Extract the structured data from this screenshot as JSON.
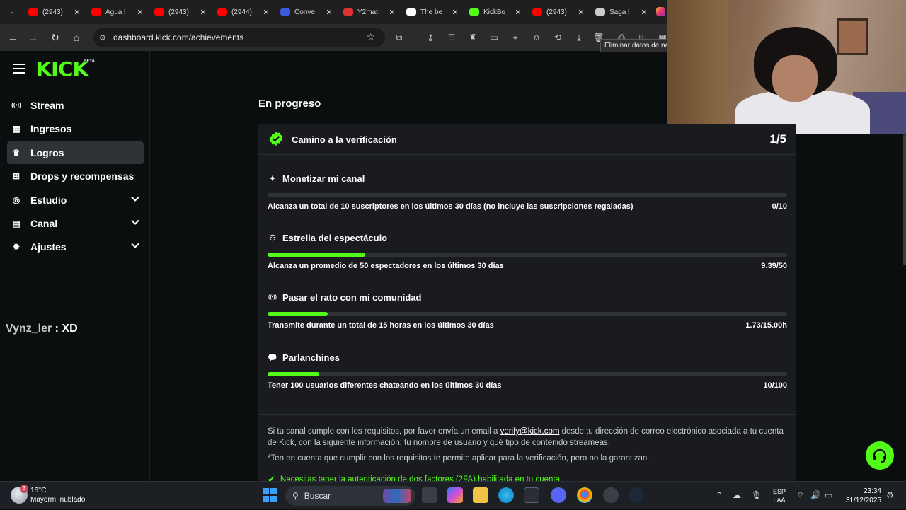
{
  "browser": {
    "tabs": [
      {
        "title": "(2943)",
        "color": "#ff0000"
      },
      {
        "title": "Agua l",
        "color": "#ff0000"
      },
      {
        "title": "(2943)",
        "color": "#ff0000"
      },
      {
        "title": "(2944)",
        "color": "#ff0000"
      },
      {
        "title": "Conve",
        "color": "#3b5bdb"
      },
      {
        "title": "Y2mat",
        "color": "#e03131"
      },
      {
        "title": "The be",
        "color": "#ffffff"
      },
      {
        "title": "KickBo",
        "color": "#53fc18"
      },
      {
        "title": "(2943)",
        "color": "#ff0000"
      },
      {
        "title": "Saga l",
        "color": "#cccccc"
      }
    ],
    "url": "dashboard.kick.com/achievements",
    "tooltip": "Eliminar datos de na"
  },
  "sidebar": {
    "logo": "KICK",
    "logo_badge": "BETA",
    "items": [
      {
        "label": "Stream",
        "icon": "stream-icon",
        "active": false,
        "expandable": false
      },
      {
        "label": "Ingresos",
        "icon": "revenue-icon",
        "active": false,
        "expandable": false
      },
      {
        "label": "Logros",
        "icon": "trophy-icon",
        "active": true,
        "expandable": false
      },
      {
        "label": "Drops y recompensas",
        "icon": "drops-icon",
        "active": false,
        "expandable": false
      },
      {
        "label": "Estudio",
        "icon": "studio-icon",
        "active": false,
        "expandable": true
      },
      {
        "label": "Canal",
        "icon": "channel-icon",
        "active": false,
        "expandable": true
      },
      {
        "label": "Ajustes",
        "icon": "settings-icon",
        "active": false,
        "expandable": true
      }
    ]
  },
  "overlay": {
    "user": "Vynz_ler",
    "message": ": XD"
  },
  "main": {
    "section_title": "En progreso",
    "card": {
      "title": "Camino a la verificación",
      "count": "1/5",
      "items": [
        {
          "title": "Monetizar mi canal",
          "icon": "sparkle-icon",
          "desc": "Alcanza un total de 10 suscriptores en los últimos 30 días (no incluye las suscripciones regaladas)",
          "value": "0/10",
          "progress": 0.0
        },
        {
          "title": "Estrella del espectáculo",
          "icon": "audience-icon",
          "desc": "Alcanza un promedio de 50 espectadores en los últimos 30 días",
          "value": "9.39/50",
          "progress": 0.1878
        },
        {
          "title": "Pasar el rato con mi comunidad",
          "icon": "broadcast-icon",
          "desc": "Transmite durante un total de 15 horas en los últimos 30 días",
          "value": "1.73/15.00h",
          "progress": 0.1153
        },
        {
          "title": "Parlanchines",
          "icon": "chat-bubble-icon",
          "desc": "Tener 100 usuarios diferentes chateando en los últimos 30 días",
          "value": "10/100",
          "progress": 0.1
        }
      ],
      "info_pre": "Si tu canal cumple con los requisitos, por favor envía un email a ",
      "info_email": "verify@kick.com",
      "info_post": " desde tu dirección de correo electrónico asociada a tu cuenta de Kick, con la siguiente información: tu nombre de usuario y qué tipo de contenido streameas.",
      "disclaimer": "*Ten en cuenta que cumplir con los requisitos te permite aplicar para la verificación, pero no la garantizan.",
      "requirement": "Necesitas tener la autenticación de dos factores (2FA) habilitada en tu cuenta"
    }
  },
  "taskbar": {
    "temperature": "16°C",
    "weather": "Mayorm. nublado",
    "weather_badge": "3",
    "search": "Buscar",
    "lang_1": "ESP",
    "lang_2": "LAA",
    "time": "23:34",
    "date": "31/12/2025"
  },
  "colors": {
    "accent": "#53fc18",
    "background": "#0b0e0f",
    "card": "#191b1f"
  }
}
